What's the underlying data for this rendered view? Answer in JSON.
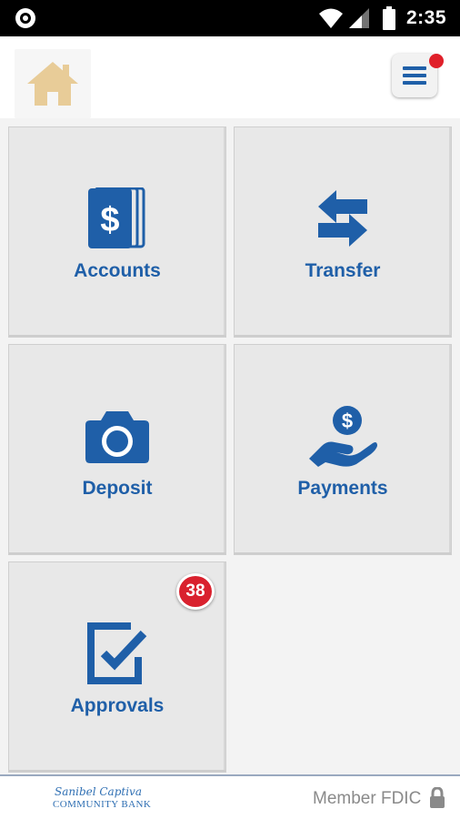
{
  "status_bar": {
    "time": "2:35",
    "icons": [
      "screen-record-icon",
      "wifi-icon",
      "signal-icon",
      "battery-icon"
    ]
  },
  "app_bar": {
    "home_icon": "home-icon",
    "menu_icon": "hamburger-menu-icon",
    "menu_notification": true
  },
  "tiles": [
    {
      "label": "Accounts",
      "icon": "accounts-dollar-icon"
    },
    {
      "label": "Transfer",
      "icon": "transfer-arrows-icon"
    },
    {
      "label": "Deposit",
      "icon": "camera-icon"
    },
    {
      "label": "Payments",
      "icon": "payment-hand-icon"
    },
    {
      "label": "Approvals",
      "icon": "approvals-checkbox-icon",
      "badge": "38"
    }
  ],
  "footer": {
    "logo_line1": "Sanibel Captiva",
    "logo_line2": "COMMUNITY BANK",
    "member_text": "Member FDIC"
  },
  "colors": {
    "primary_blue": "#1f5fa8",
    "tile_bg": "#e8e8e8",
    "badge_red": "#d9212e",
    "home_icon": "#e8cc98"
  }
}
